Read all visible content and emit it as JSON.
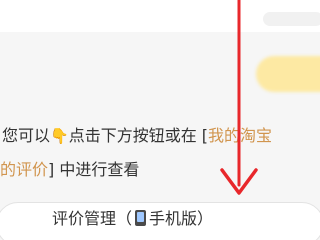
{
  "info": {
    "line1_a": "您可以",
    "line1_b": "点击下方按钮或在 [",
    "line1_c": "我的淘宝",
    "line2_a": "的评价",
    "line2_b": "] 中进行查看"
  },
  "finger_icon": "pointing-down-icon",
  "phone_icon": "mobile-phone-icon",
  "button": {
    "label_before": "评价管理（",
    "label_after": "手机版）"
  },
  "colors": {
    "arrow": "#e8272b",
    "link": "#d1954e",
    "highlight": "#fde9a3"
  }
}
